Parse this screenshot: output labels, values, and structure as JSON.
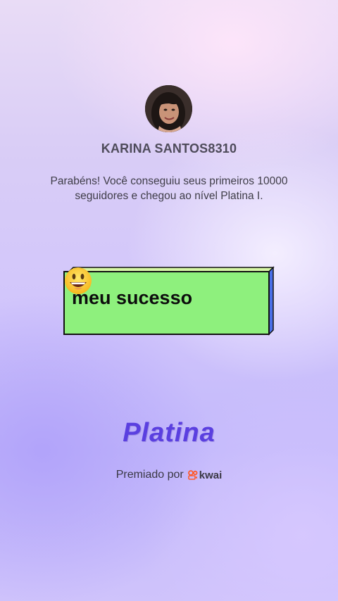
{
  "profile": {
    "username": "KARINA SANTOS8310"
  },
  "message": "Parabéns! Você conseguiu seus primeiros 10000 seguidores e chegou ao nível Platina I.",
  "caption_box": {
    "text": "meu sucesso",
    "emoji": "grinning-face",
    "fill_color": "#8ef07d",
    "side_color": "#4a6fe8"
  },
  "level": {
    "name": "Platina",
    "color": "#5a3fe0"
  },
  "footer": {
    "awarded_by": "Premiado por",
    "brand": "kwai",
    "brand_icon": "kwai-logo-icon",
    "brand_color": "#ff5a2c"
  }
}
